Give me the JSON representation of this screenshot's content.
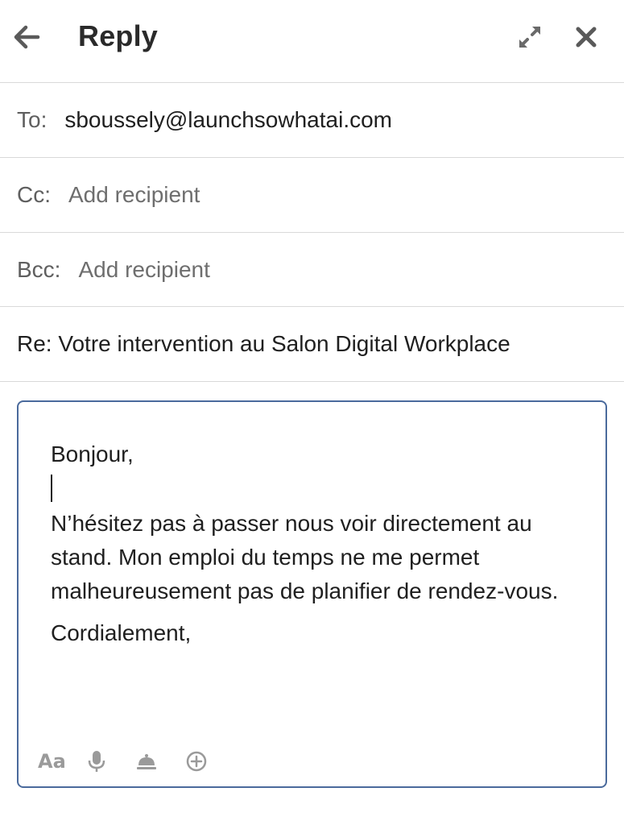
{
  "header": {
    "title": "Reply",
    "back_icon": "arrow-left-icon",
    "expand_icon": "expand-arrows-icon",
    "close_icon": "close-x-icon"
  },
  "to": {
    "label": "To:",
    "value": "sboussely@launchsowhatai.com"
  },
  "cc": {
    "label": "Cc:",
    "placeholder": "Add recipient"
  },
  "bcc": {
    "label": "Bcc:",
    "placeholder": "Add recipient"
  },
  "subject": "Re: Votre intervention au Salon Digital Workplace",
  "body": {
    "greeting": "Bonjour,",
    "paragraph": "N’hésitez pas à passer nous voir directement au stand. Mon emploi du temps ne me permet malheureusement pas de planifier de rendez-vous.",
    "closing": "Cordialement,"
  },
  "toolbar": {
    "format_label": "Aa",
    "icons": [
      "text-format-icon",
      "microphone-icon",
      "bell-icon",
      "plus-circle-icon"
    ]
  },
  "colors": {
    "compose_border": "#4a6a9c",
    "divider": "#d9d9d9",
    "icon_gray": "#9a9a9a"
  }
}
